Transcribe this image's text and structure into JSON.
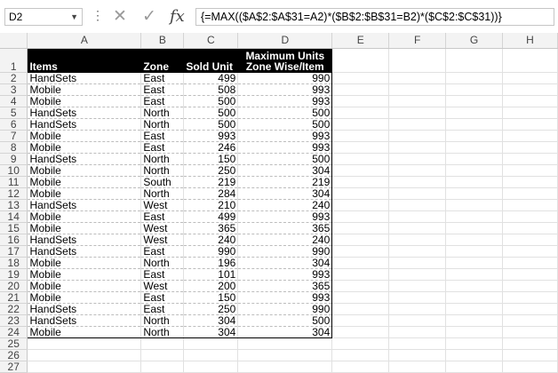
{
  "formula_bar": {
    "name_box": "D2",
    "formula": "{=MAX(($A$2:$A$31=A2)*($B$2:$B$31=B2)*($C$2:$C$31))}"
  },
  "icons": {
    "cancel": "x-icon",
    "enter": "check-icon",
    "function": "fx-icon"
  },
  "columns": [
    "A",
    "B",
    "C",
    "D",
    "E",
    "F",
    "G",
    "H"
  ],
  "header": {
    "items": "Items",
    "zone": "Zone",
    "sold_unit": "Sold Unit",
    "max_line1": "Maximum Units",
    "max_line2": "Zone Wise/Item"
  },
  "rows": [
    {
      "r": "1"
    },
    {
      "r": "2",
      "item": "HandSets",
      "zone": "East",
      "sold": "499",
      "max": "990"
    },
    {
      "r": "3",
      "item": "Mobile",
      "zone": "East",
      "sold": "508",
      "max": "993"
    },
    {
      "r": "4",
      "item": "Mobile",
      "zone": "East",
      "sold": "500",
      "max": "993"
    },
    {
      "r": "5",
      "item": "HandSets",
      "zone": "North",
      "sold": "500",
      "max": "500"
    },
    {
      "r": "6",
      "item": "HandSets",
      "zone": "North",
      "sold": "500",
      "max": "500"
    },
    {
      "r": "7",
      "item": "Mobile",
      "zone": "East",
      "sold": "993",
      "max": "993"
    },
    {
      "r": "8",
      "item": "Mobile",
      "zone": "East",
      "sold": "246",
      "max": "993"
    },
    {
      "r": "9",
      "item": "HandSets",
      "zone": "North",
      "sold": "150",
      "max": "500"
    },
    {
      "r": "10",
      "item": "Mobile",
      "zone": "North",
      "sold": "250",
      "max": "304"
    },
    {
      "r": "11",
      "item": "Mobile",
      "zone": "South",
      "sold": "219",
      "max": "219"
    },
    {
      "r": "12",
      "item": "Mobile",
      "zone": "North",
      "sold": "284",
      "max": "304"
    },
    {
      "r": "13",
      "item": "HandSets",
      "zone": "West",
      "sold": "210",
      "max": "240"
    },
    {
      "r": "14",
      "item": "Mobile",
      "zone": "East",
      "sold": "499",
      "max": "993"
    },
    {
      "r": "15",
      "item": "Mobile",
      "zone": "West",
      "sold": "365",
      "max": "365"
    },
    {
      "r": "16",
      "item": "HandSets",
      "zone": "West",
      "sold": "240",
      "max": "240"
    },
    {
      "r": "17",
      "item": "HandSets",
      "zone": "East",
      "sold": "990",
      "max": "990"
    },
    {
      "r": "18",
      "item": "Mobile",
      "zone": "North",
      "sold": "196",
      "max": "304"
    },
    {
      "r": "19",
      "item": "Mobile",
      "zone": "East",
      "sold": "101",
      "max": "993"
    },
    {
      "r": "20",
      "item": "Mobile",
      "zone": "West",
      "sold": "200",
      "max": "365"
    },
    {
      "r": "21",
      "item": "Mobile",
      "zone": "East",
      "sold": "150",
      "max": "993"
    },
    {
      "r": "22",
      "item": "HandSets",
      "zone": "East",
      "sold": "250",
      "max": "990"
    },
    {
      "r": "23",
      "item": "HandSets",
      "zone": "North",
      "sold": "304",
      "max": "500"
    },
    {
      "r": "24",
      "item": "Mobile",
      "zone": "North",
      "sold": "304",
      "max": "304"
    },
    {
      "r": "25"
    },
    {
      "r": "26"
    },
    {
      "r": "27"
    }
  ]
}
